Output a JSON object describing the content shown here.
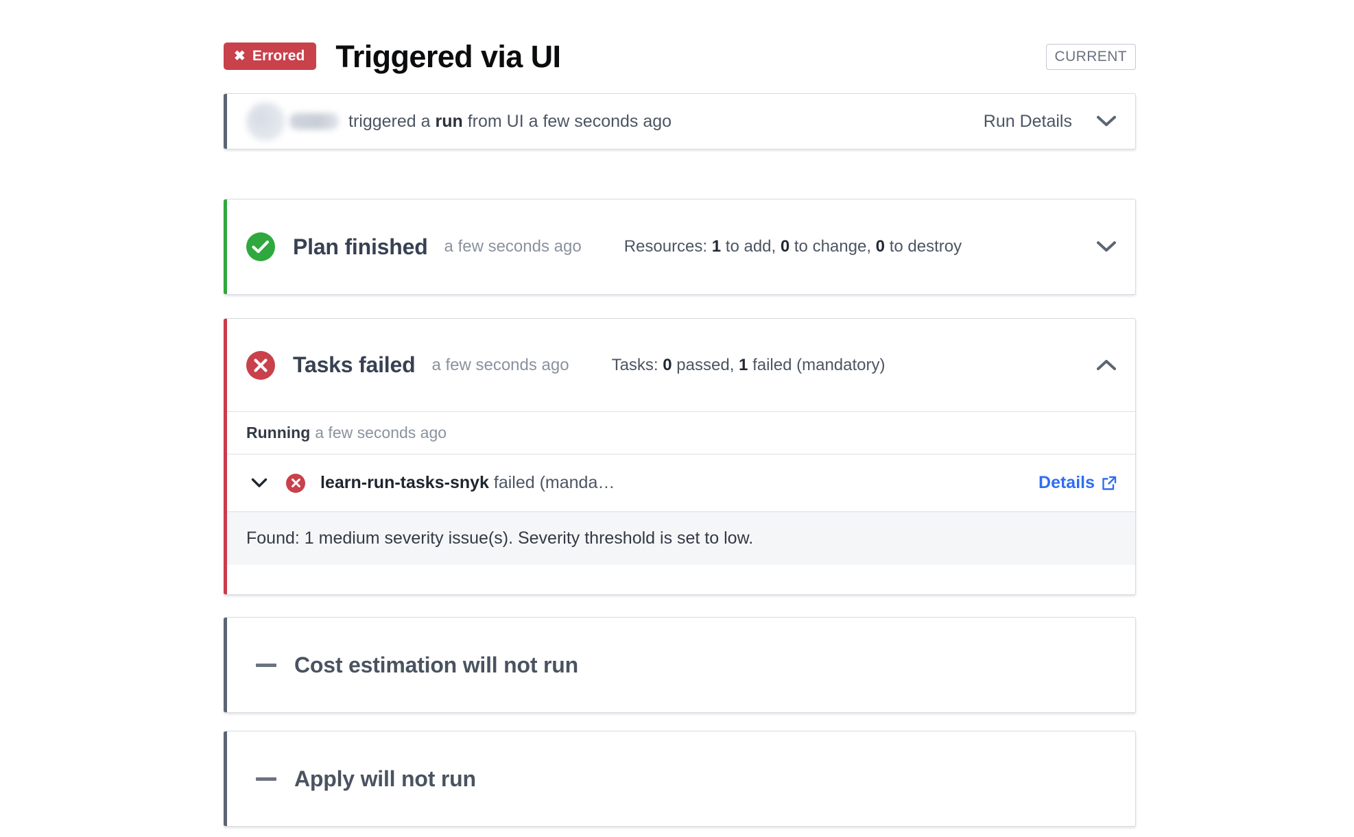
{
  "header": {
    "status_badge": {
      "icon": "x-icon",
      "label": "Errored"
    },
    "title": "Triggered via UI",
    "current_chip": "CURRENT"
  },
  "trigger_card": {
    "avatar": "redacted-avatar",
    "username": "redacted-username",
    "text_before": "triggered a",
    "text_bold": "run",
    "text_after": "from UI a few seconds ago",
    "run_details_label": "Run Details",
    "chevron": "chevron-down-icon"
  },
  "stages": [
    {
      "key": "plan",
      "icon": "check-circle-icon",
      "accent": "green",
      "title": "Plan finished",
      "time": "a few seconds ago",
      "meta_prefix": "Resources:",
      "meta_add_count": "1",
      "meta_add_label": "to add,",
      "meta_change_count": "0",
      "meta_change_label": "to change,",
      "meta_destroy_count": "0",
      "meta_destroy_label": "to destroy",
      "chevron": "chevron-down-icon"
    },
    {
      "key": "tasks",
      "icon": "x-circle-icon",
      "accent": "red",
      "title": "Tasks failed",
      "time": "a few seconds ago",
      "meta_prefix": "Tasks:",
      "meta_passed_count": "0",
      "meta_passed_label": "passed,",
      "meta_failed_count": "1",
      "meta_failed_label": "failed (mandatory)",
      "chevron": "chevron-up-icon"
    }
  ],
  "tasks_section": {
    "stage_label": "Running",
    "stage_time": "a few seconds ago",
    "task": {
      "chevron": "chevron-down-icon",
      "icon": "x-circle-icon",
      "name": "learn-run-tasks-snyk",
      "status_text": "failed (manda…",
      "details_label": "Details",
      "details_icon": "external-link-icon"
    },
    "output": "Found: 1 medium severity issue(s). Severity threshold is set to low."
  },
  "skipped_stages": [
    {
      "key": "cost",
      "icon": "dash-icon",
      "title": "Cost estimation will not run"
    },
    {
      "key": "apply",
      "icon": "dash-icon",
      "title": "Apply will not run"
    }
  ],
  "colors": {
    "error_red": "#c8414b",
    "success_green": "#2fa83d",
    "accent_slate": "#5c6573",
    "link_blue": "#2f6ef0",
    "muted_text": "#8a929e",
    "body_text": "#4c5562"
  }
}
